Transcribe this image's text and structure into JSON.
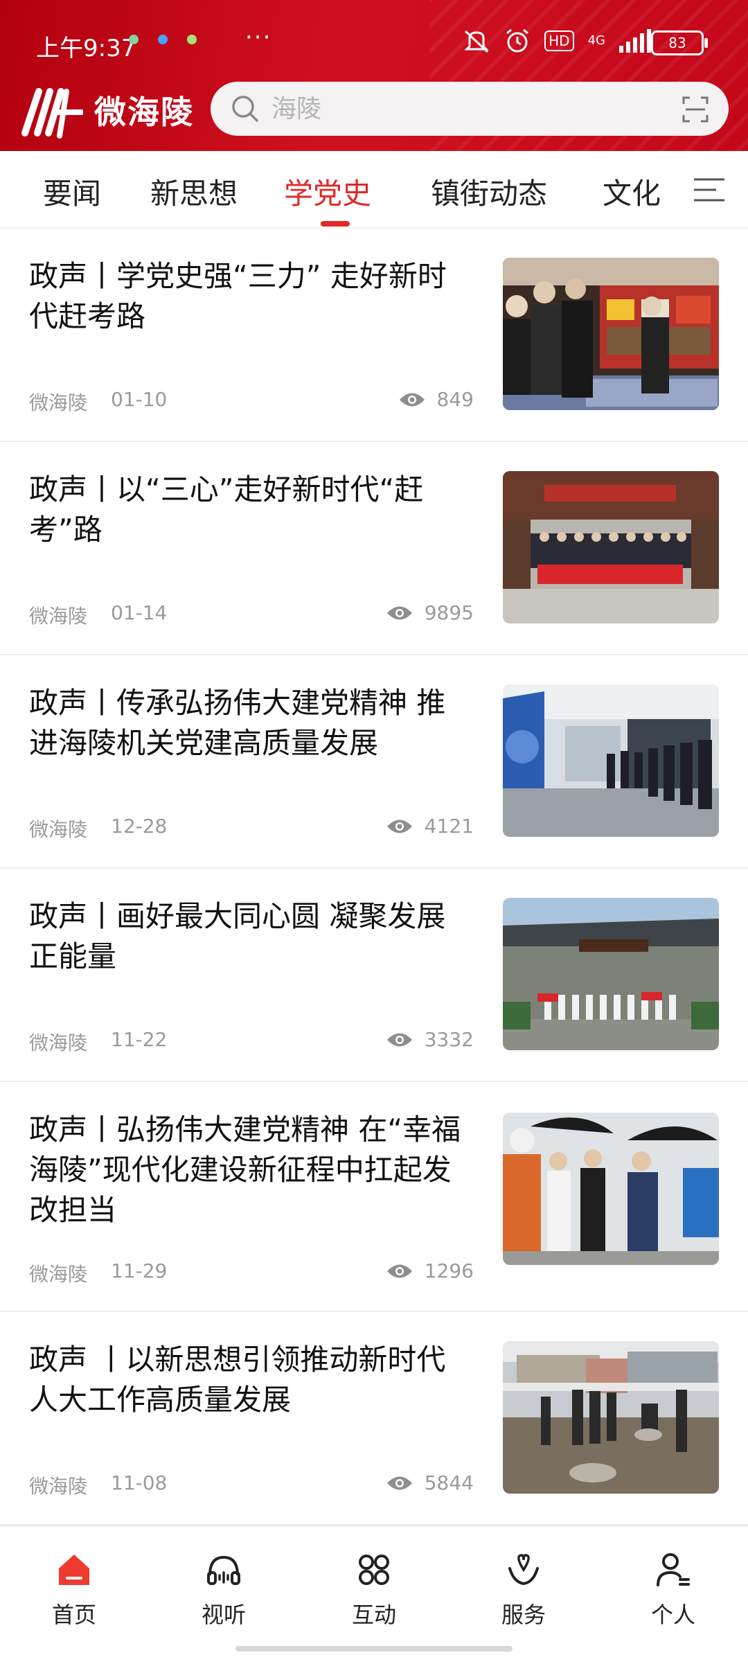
{
  "status_bar": {
    "time": "上午9:37",
    "more": "···",
    "hd": "HD",
    "network": "4G",
    "battery": "83"
  },
  "header": {
    "app_name": "微海陵",
    "search_placeholder": "海陵"
  },
  "tabs": [
    {
      "label": "要闻"
    },
    {
      "label": "新思想"
    },
    {
      "label": "学党史"
    },
    {
      "label": "镇街动态"
    },
    {
      "label": "文化"
    }
  ],
  "news": [
    {
      "title": "政声丨学党史强“三力” 走好新时代赶考路",
      "source": "微海陵",
      "date": "01-10",
      "views": "849"
    },
    {
      "title": "政声丨以“三心”走好新时代“赶考”路",
      "source": "微海陵",
      "date": "01-14",
      "views": "9895"
    },
    {
      "title": "政声丨传承弘扬伟大建党精神 推进海陵机关党建高质量发展",
      "source": "微海陵",
      "date": "12-28",
      "views": "4121"
    },
    {
      "title": "政声丨画好最大同心圆 凝聚发展正能量",
      "source": "微海陵",
      "date": "11-22",
      "views": "3332"
    },
    {
      "title": "政声丨弘扬伟大建党精神 在“幸福海陵”现代化建设新征程中扛起发改担当",
      "source": "微海陵",
      "date": "11-29",
      "views": "1296"
    },
    {
      "title": "政声 丨以新思想引领推动新时代人大工作高质量发展",
      "source": "微海陵",
      "date": "11-08",
      "views": "5844"
    }
  ],
  "bottom_nav": [
    {
      "label": "首页",
      "icon": "home-icon"
    },
    {
      "label": "视听",
      "icon": "headphones-icon"
    },
    {
      "label": "互动",
      "icon": "interact-icon"
    },
    {
      "label": "服务",
      "icon": "service-icon"
    },
    {
      "label": "个人",
      "icon": "person-icon"
    }
  ],
  "colors": {
    "brand": "#c8101e",
    "active_tab": "#e02a2a",
    "meta_text": "#9a9a9a"
  }
}
